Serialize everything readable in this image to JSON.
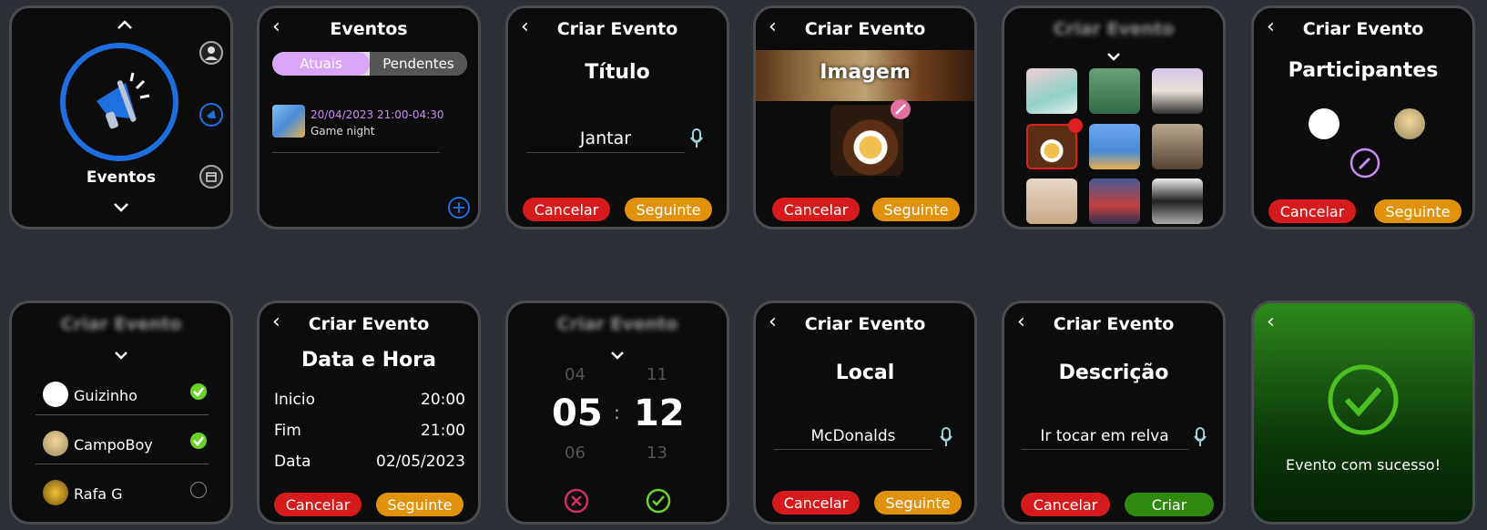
{
  "s1": {
    "label": "Eventos"
  },
  "s2": {
    "title": "Eventos",
    "tabs": [
      "Atuais",
      "Pendentes"
    ],
    "event_date": "20/04/2023 21:00-04:30",
    "event_name": "Game night"
  },
  "common": {
    "create_title": "Criar Evento",
    "cancel": "Cancelar",
    "next": "Seguinte",
    "create": "Criar",
    "back": "‹",
    "sep": ":"
  },
  "s3": {
    "heading": "Título",
    "value": "Jantar"
  },
  "s4": {
    "heading": "Imagem"
  },
  "s6": {
    "heading": "Participantes"
  },
  "s7": {
    "participants": [
      "Guizinho",
      "CampoBoy",
      "Rafa G"
    ]
  },
  "s8": {
    "heading": "Data e Hora",
    "rows": [
      {
        "label": "Inicio",
        "value": "20:00"
      },
      {
        "label": "Fim",
        "value": "21:00"
      },
      {
        "label": "Data",
        "value": "02/05/2023"
      }
    ]
  },
  "s9": {
    "hour_prev": "04",
    "hour": "05",
    "hour_next": "06",
    "min_prev": "11",
    "min": "12",
    "min_next": "13"
  },
  "s10": {
    "heading": "Local",
    "value": "McDonalds"
  },
  "s11": {
    "heading": "Descrição",
    "value": "Ir tocar em relva"
  },
  "s12": {
    "message": "Evento com sucesso!"
  },
  "colors": {
    "accent_blue": "#1e6fe0",
    "purple": "#c88cf5",
    "red": "#d51b1b",
    "orange": "#e0920c",
    "green": "#2f8a0f",
    "success_green": "#4cc020"
  }
}
